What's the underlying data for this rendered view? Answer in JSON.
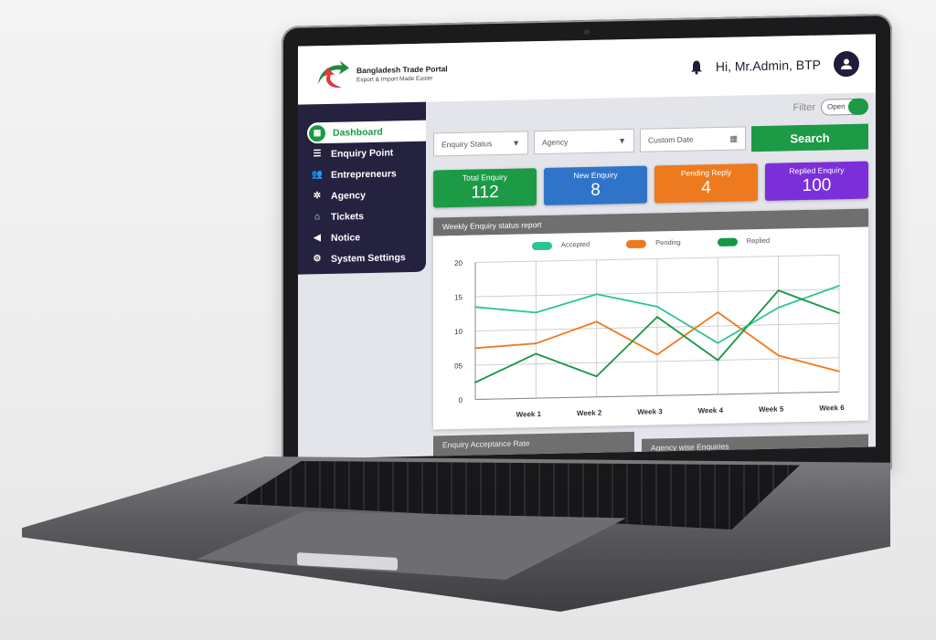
{
  "header": {
    "brand_title": "Bangladesh Trade Portal",
    "brand_tagline": "Export & Import Made Easier",
    "greeting": "Hi, Mr.Admin, BTP",
    "notification_icon": "bell-icon",
    "avatar_icon": "user-icon"
  },
  "sidebar": {
    "items": [
      {
        "label": "Dashboard",
        "icon": "dashboard-icon",
        "active": true
      },
      {
        "label": "Enquiry Point",
        "icon": "list-icon",
        "active": false
      },
      {
        "label": "Entrepreneurs",
        "icon": "users-icon",
        "active": false
      },
      {
        "label": "Agency",
        "icon": "group-icon",
        "active": false
      },
      {
        "label": "Tickets",
        "icon": "ticket-icon",
        "active": false
      },
      {
        "label": "Notice",
        "icon": "megaphone-icon",
        "active": false
      },
      {
        "label": "System Settings",
        "icon": "gear-icon",
        "active": false
      }
    ]
  },
  "filter": {
    "label": "Filter",
    "toggle_label": "Open",
    "toggle_on": true
  },
  "controls": {
    "enquiry_status": {
      "placeholder": "Enquiry Status"
    },
    "agency": {
      "placeholder": "Agency"
    },
    "custom_date": {
      "placeholder": "Custom Date"
    },
    "search_label": "Search"
  },
  "stats": [
    {
      "label": "Total Enquiry",
      "value": "112",
      "color": "#1c9a45"
    },
    {
      "label": "New Enquiry",
      "value": "8",
      "color": "#2f74c9"
    },
    {
      "label": "Pending Reply",
      "value": "4",
      "color": "#ee7a1f"
    },
    {
      "label": "Replied Enquiry",
      "value": "100",
      "color": "#7b2fd9"
    }
  ],
  "weekly_report": {
    "title": "Weekly Enquiry status report"
  },
  "bottom_panels": [
    {
      "title": "Enquiry Acceptance Rate"
    },
    {
      "title": "Agency wise Enquiries"
    }
  ],
  "chart_data": {
    "type": "line",
    "title": "Weekly Enquiry status report",
    "xlabel": "",
    "ylabel": "",
    "categories": [
      "",
      "Week 1",
      "Week 2",
      "Week 3",
      "Week 4",
      "Week 5",
      "Week 6"
    ],
    "y_ticks": [
      "0",
      "05",
      "10",
      "15",
      "20"
    ],
    "ylim": [
      0,
      20
    ],
    "grid": true,
    "legend": "top-center",
    "series": [
      {
        "name": "Accepted",
        "color": "#2ec492",
        "values": [
          13.5,
          12.5,
          15,
          13,
          7.5,
          12.5,
          15.5
        ]
      },
      {
        "name": "Pending",
        "color": "#ee7a1f",
        "values": [
          7.5,
          8,
          11,
          6,
          12,
          5.5,
          3
        ]
      },
      {
        "name": "Replied",
        "color": "#159640",
        "values": [
          2.5,
          6.5,
          3,
          11.5,
          5,
          15,
          11.5
        ]
      }
    ]
  }
}
